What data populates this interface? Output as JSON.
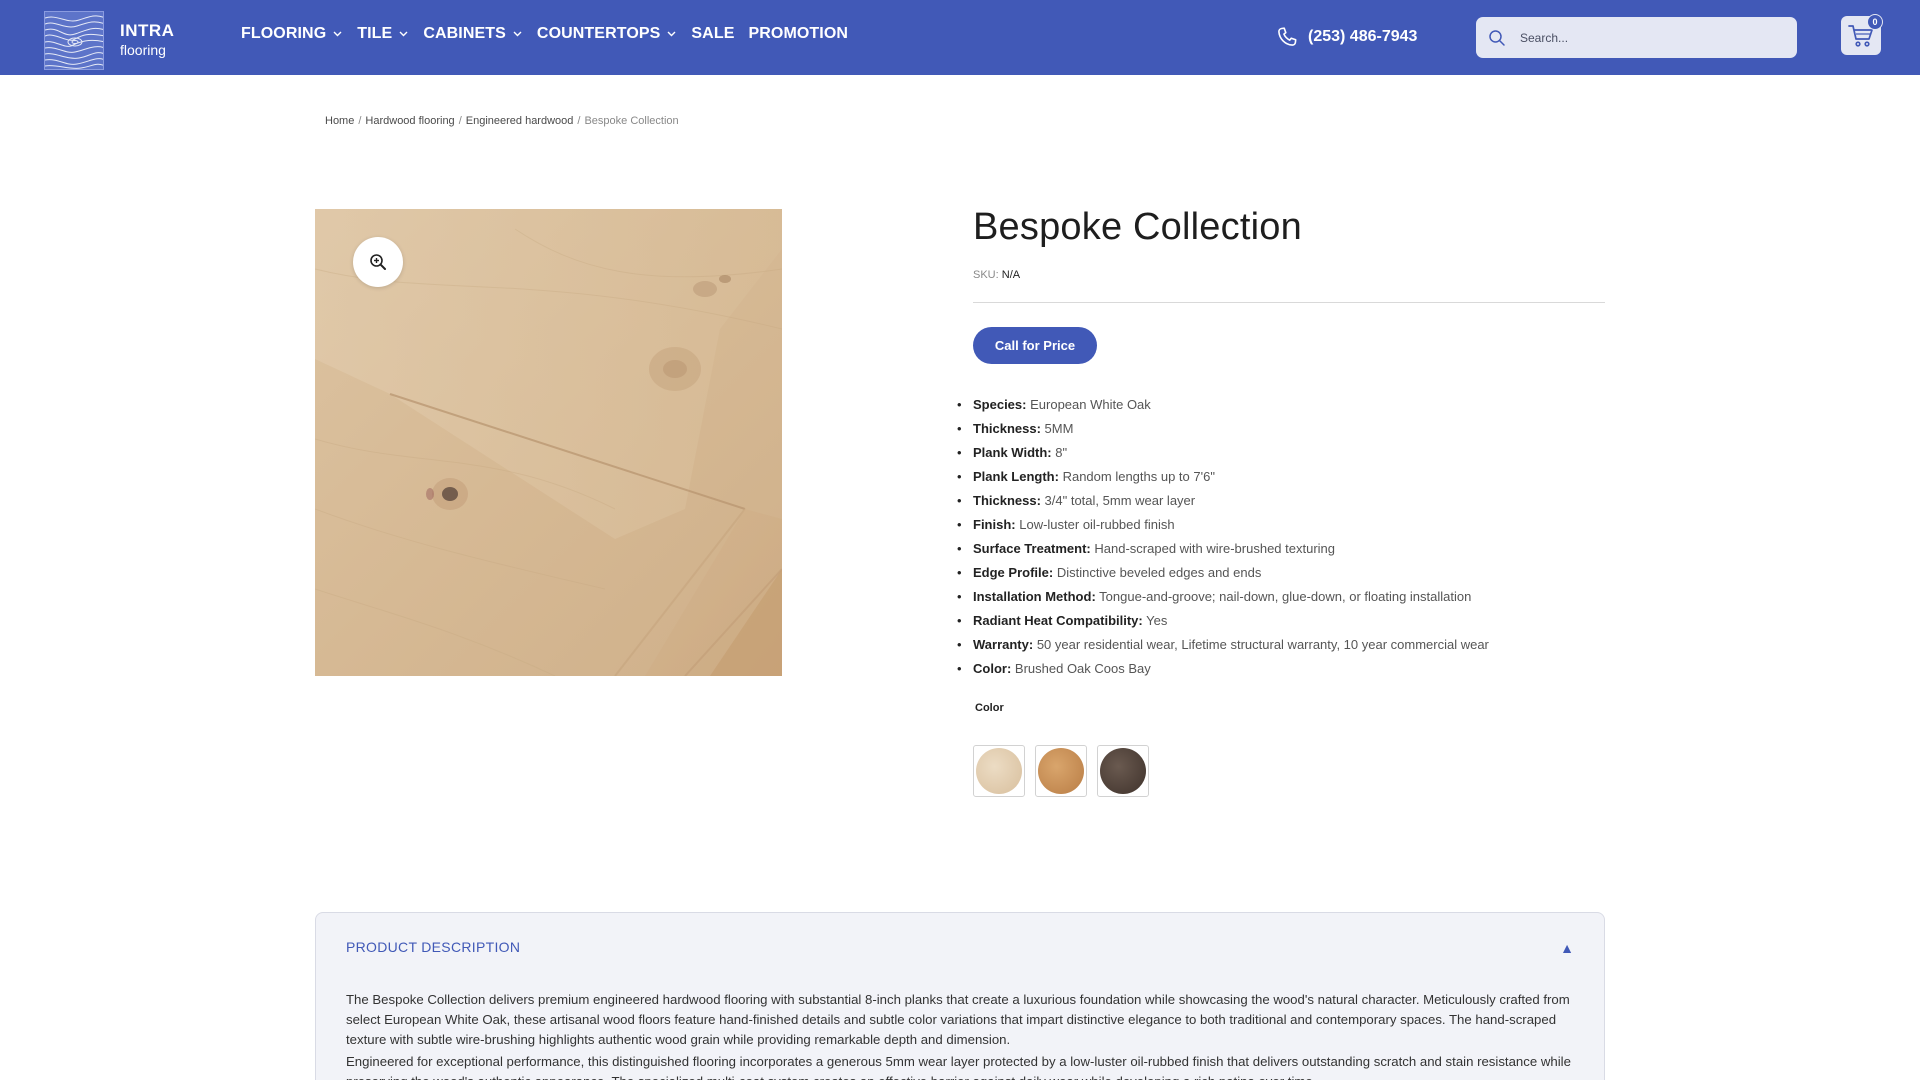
{
  "header": {
    "brand": "INTRA",
    "brand_sub": "flooring",
    "nav": [
      {
        "label": "FLOORING",
        "dropdown": true
      },
      {
        "label": "TILE",
        "dropdown": true
      },
      {
        "label": "CABINETS",
        "dropdown": true
      },
      {
        "label": "COUNTERTOPS",
        "dropdown": true
      },
      {
        "label": "SALE",
        "dropdown": false
      },
      {
        "label": "PROMOTION",
        "dropdown": false
      }
    ],
    "phone": "(253) 486-7943",
    "search_placeholder": "Search...",
    "cart_count": "0",
    "bg_color": "#4159b7"
  },
  "breadcrumb": {
    "home": "Home",
    "level1": "Hardwood flooring",
    "level2": "Engineered hardwood",
    "current": "Bespoke Collection",
    "sep": "/"
  },
  "product": {
    "title": "Bespoke Collection",
    "sku_label": "SKU:",
    "sku_value": "N/A",
    "price_button": "Call for Price",
    "specs": [
      {
        "k": "Species:",
        "v": "European White Oak"
      },
      {
        "k": "Thickness:",
        "v": "5MM"
      },
      {
        "k": "Plank Width:",
        "v": "8\""
      },
      {
        "k": "Plank Length:",
        "v": "Random lengths up to 7'6\""
      },
      {
        "k": "Thickness:",
        "v": "3/4\" total, 5mm wear layer"
      },
      {
        "k": "Finish:",
        "v": "Low-luster oil-rubbed finish"
      },
      {
        "k": "Surface Treatment:",
        "v": "Hand-scraped with wire-brushed texturing"
      },
      {
        "k": "Edge Profile:",
        "v": "Distinctive beveled edges and ends"
      },
      {
        "k": "Installation Method:",
        "v": "Tongue-and-groove; nail-down, glue-down, or floating installation"
      },
      {
        "k": "Radiant Heat Compatibility:",
        "v": "Yes"
      },
      {
        "k": "Warranty:",
        "v": "50 year residential wear, Lifetime structural warranty, 10 year commercial wear"
      },
      {
        "k": "Color:",
        "v": "Brushed Oak Coos Bay"
      }
    ],
    "color_label": "Color",
    "swatch_colors": [
      "#e4d1b5",
      "#c98f55",
      "#4f4038"
    ]
  },
  "description": {
    "heading": "PRODUCT DESCRIPTION",
    "toggle": "▲",
    "p1": "The Bespoke Collection delivers premium engineered hardwood flooring with substantial 8-inch planks that create a luxurious foundation while showcasing the wood's natural character. Meticulously crafted from select European White Oak, these artisanal wood floors feature hand-finished details and subtle color variations that impart distinctive elegance to both traditional and contemporary spaces. The hand-scraped texture with subtle wire-brushing highlights authentic wood grain while providing remarkable depth and dimension.",
    "p2": "Engineered for exceptional performance, this distinguished flooring incorporates a generous 5mm wear layer protected by a low-luster oil-rubbed finish that delivers outstanding scratch and stain resistance while preserving the wood's authentic appearance. The specialized multi-coat system creates an effective barrier against daily wear while developing a rich patina over time."
  }
}
